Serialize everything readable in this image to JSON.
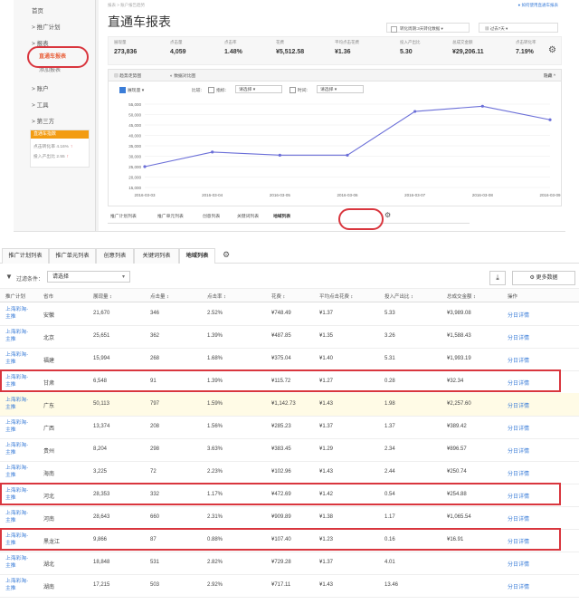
{
  "top": {
    "sidebar": {
      "items": [
        {
          "label": "首页"
        },
        {
          "label": "> 推广计划"
        },
        {
          "label": "> 报表"
        },
        {
          "label": "直通车报表"
        },
        {
          "label": "添加报表"
        },
        {
          "label": "> 账户"
        },
        {
          "label": "> 工具"
        },
        {
          "label": "> 第三方"
        }
      ],
      "promo": {
        "head": "直通车指数",
        "rows": [
          {
            "label": "点击转化率 4.16%",
            "arrow": "↑"
          },
          {
            "label": "投入产出比 2.55",
            "arrow": "↑"
          }
        ]
      }
    },
    "breadcrumb": "报表 > 账户报告趋势",
    "top_link": "如何使用直通车报表",
    "page_title": "直通车报表",
    "date_select": "转化周期:3天转化数据",
    "date_range": "过去7天",
    "metrics": [
      {
        "label": "展现量",
        "value": "273,836"
      },
      {
        "label": "点击量",
        "value": "4,059"
      },
      {
        "label": "点击率",
        "value": "1.48%"
      },
      {
        "label": "花费",
        "value": "¥5,512.58"
      },
      {
        "label": "平均点击花费",
        "value": "¥1.36"
      },
      {
        "label": "投入产出比",
        "value": "5.30"
      },
      {
        "label": "总成交金额",
        "value": "¥29,206.11"
      },
      {
        "label": "点击转化率",
        "value": "7.19%"
      }
    ],
    "chart_tabs": [
      "趋势走势图",
      "数据对比图"
    ],
    "collapse_label": "隐藏 ^",
    "chart_options": {
      "metric_a": "展现量",
      "compare_label": "比较:",
      "metric_b_label": "指标:",
      "metric_b_select": "请选择",
      "metric_c_label": "时间:",
      "metric_c_select": "请选择"
    },
    "bottom_tabs": [
      "推广计划列表",
      "推广单元列表",
      "创意列表",
      "关键词列表",
      "地域列表"
    ]
  },
  "chart_data": {
    "type": "line",
    "title": "",
    "xlabel": "",
    "ylabel": "",
    "categories": [
      "2016-03-03",
      "2016-03-04",
      "2016-03-05",
      "2016-03-06",
      "2016-03-07",
      "2016-03-08",
      "2016-03-09"
    ],
    "series": [
      {
        "name": "展现量",
        "values": [
          25000,
          32000,
          30500,
          30500,
          51500,
          54000,
          47500
        ]
      }
    ],
    "ylim": [
      15000,
      55000
    ],
    "yticks": [
      "15,000",
      "20,000",
      "25,000",
      "30,000",
      "35,000",
      "40,000",
      "45,000",
      "50,000",
      "55,000"
    ],
    "grid": true,
    "color": "#6b6fd8"
  },
  "bottom": {
    "tabs": [
      "推广计划列表",
      "推广单元列表",
      "创意列表",
      "关键词列表",
      "地域列表"
    ],
    "filter_label": "过滤条件：",
    "filter_select": "请选择",
    "more_button": "更多数据",
    "columns": [
      "推广计划",
      "省市",
      "展现量 ↕",
      "点击量 ↕",
      "点击率 ↕",
      "花费 ↕",
      "平均点击花费 ↕",
      "投入产出比 ↕",
      "总成交金额 ↕",
      "操作"
    ],
    "rows": [
      {
        "plan": "上海彩淘-\n主推",
        "region": "安徽",
        "impr": "21,670",
        "clicks": "346",
        "ctr": "2.52%",
        "cost": "¥748.49",
        "cpc": "¥1.37",
        "roi": "5.33",
        "gmv": "¥3,989.08",
        "op": "分日详情"
      },
      {
        "plan": "上海彩淘-\n主推",
        "region": "北京",
        "impr": "25,651",
        "clicks": "362",
        "ctr": "1.39%",
        "cost": "¥487.85",
        "cpc": "¥1.35",
        "roi": "3.26",
        "gmv": "¥1,588.43",
        "op": "分日详情"
      },
      {
        "plan": "上海彩淘-\n主推",
        "region": "福建",
        "impr": "15,994",
        "clicks": "268",
        "ctr": "1.68%",
        "cost": "¥375.04",
        "cpc": "¥1.40",
        "roi": "5.31",
        "gmv": "¥1,993.19",
        "op": "分日详情"
      },
      {
        "plan": "上海彩淘-\n主推",
        "region": "甘肃",
        "impr": "6,548",
        "clicks": "91",
        "ctr": "1.39%",
        "cost": "¥115.72",
        "cpc": "¥1.27",
        "roi": "0.28",
        "gmv": "¥32.34",
        "op": "分日详情"
      },
      {
        "plan": "上海彩淘-\n主推",
        "region": "广东",
        "impr": "50,113",
        "clicks": "797",
        "ctr": "1.59%",
        "cost": "¥1,142.73",
        "cpc": "¥1.43",
        "roi": "1.98",
        "gmv": "¥2,257.60",
        "op": "分日详情"
      },
      {
        "plan": "上海彩淘-\n主推",
        "region": "广西",
        "impr": "13,374",
        "clicks": "208",
        "ctr": "1.56%",
        "cost": "¥285.23",
        "cpc": "¥1.37",
        "roi": "1.37",
        "gmv": "¥389.42",
        "op": "分日详情"
      },
      {
        "plan": "上海彩淘-\n主推",
        "region": "贵州",
        "impr": "8,204",
        "clicks": "298",
        "ctr": "3.63%",
        "cost": "¥383.45",
        "cpc": "¥1.29",
        "roi": "2.34",
        "gmv": "¥896.57",
        "op": "分日详情"
      },
      {
        "plan": "上海彩淘-\n主推",
        "region": "海南",
        "impr": "3,225",
        "clicks": "72",
        "ctr": "2.23%",
        "cost": "¥102.96",
        "cpc": "¥1.43",
        "roi": "2.44",
        "gmv": "¥250.74",
        "op": "分日详情"
      },
      {
        "plan": "上海彩淘-\n主推",
        "region": "河北",
        "impr": "28,353",
        "clicks": "332",
        "ctr": "1.17%",
        "cost": "¥472.69",
        "cpc": "¥1.42",
        "roi": "0.54",
        "gmv": "¥254.88",
        "op": "分日详情"
      },
      {
        "plan": "上海彩淘-\n主推",
        "region": "河南",
        "impr": "28,643",
        "clicks": "660",
        "ctr": "2.31%",
        "cost": "¥909.89",
        "cpc": "¥1.38",
        "roi": "1.17",
        "gmv": "¥1,065.54",
        "op": "分日详情"
      },
      {
        "plan": "上海彩淘-\n主推",
        "region": "黑龙江",
        "impr": "9,866",
        "clicks": "87",
        "ctr": "0.88%",
        "cost": "¥107.40",
        "cpc": "¥1.23",
        "roi": "0.16",
        "gmv": "¥16.91",
        "op": "分日详情"
      },
      {
        "plan": "上海彩淘-\n主推",
        "region": "湖北",
        "impr": "18,848",
        "clicks": "531",
        "ctr": "2.82%",
        "cost": "¥729.28",
        "cpc": "¥1.37",
        "roi": "4.01",
        "gmv": "",
        "op": "分日详情"
      },
      {
        "plan": "上海彩淘-\n主推",
        "region": "湖南",
        "impr": "17,215",
        "clicks": "503",
        "ctr": "2.92%",
        "cost": "¥717.11",
        "cpc": "¥1.43",
        "roi": "13.46",
        "gmv": "",
        "op": "分日详情"
      }
    ]
  },
  "colors": {
    "accent": "#e8613c",
    "link": "#3b7dd8",
    "highlight_box": "#d9363e",
    "row_highlight": "#fffbe6",
    "line": "#6b6fd8"
  }
}
